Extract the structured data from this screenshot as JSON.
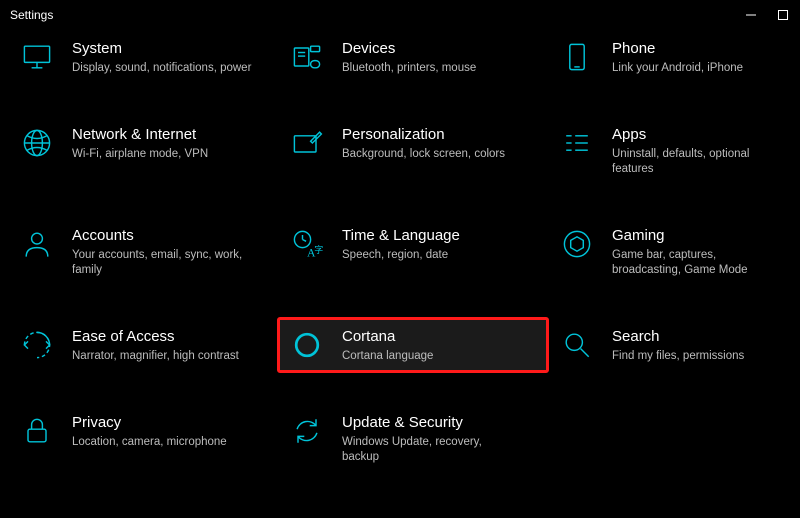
{
  "window": {
    "title": "Settings"
  },
  "items": [
    {
      "title": "System",
      "desc": "Display, sound, notifications, power"
    },
    {
      "title": "Devices",
      "desc": "Bluetooth, printers, mouse"
    },
    {
      "title": "Phone",
      "desc": "Link your Android, iPhone"
    },
    {
      "title": "Network & Internet",
      "desc": "Wi-Fi, airplane mode, VPN"
    },
    {
      "title": "Personalization",
      "desc": "Background, lock screen, colors"
    },
    {
      "title": "Apps",
      "desc": "Uninstall, defaults, optional features"
    },
    {
      "title": "Accounts",
      "desc": "Your accounts, email, sync, work, family"
    },
    {
      "title": "Time & Language",
      "desc": "Speech, region, date"
    },
    {
      "title": "Gaming",
      "desc": "Game bar, captures, broadcasting, Game Mode"
    },
    {
      "title": "Ease of Access",
      "desc": "Narrator, magnifier, high contrast"
    },
    {
      "title": "Cortana",
      "desc": "Cortana language"
    },
    {
      "title": "Search",
      "desc": "Find my files, permissions"
    },
    {
      "title": "Privacy",
      "desc": "Location, camera, microphone"
    },
    {
      "title": "Update & Security",
      "desc": "Windows Update, recovery, backup"
    }
  ]
}
